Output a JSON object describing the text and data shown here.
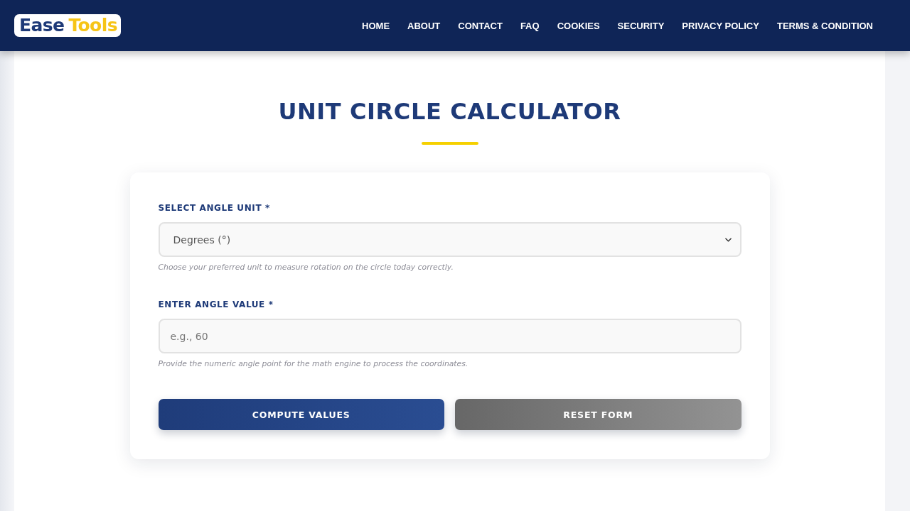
{
  "header": {
    "logo": {
      "word_1": "Ease",
      "word_2": "Tools"
    },
    "nav": [
      "HOME",
      "ABOUT",
      "CONTACT",
      "FAQ",
      "COOKIES",
      "SECURITY",
      "PRIVACY POLICY",
      "TERMS & CONDITION"
    ]
  },
  "page": {
    "title": "UNIT CIRCLE CALCULATOR"
  },
  "form": {
    "fields": [
      {
        "kind": "select",
        "label": "SELECT ANGLE UNIT *",
        "value": "Degrees (°)",
        "hint": "Choose your preferred unit to measure rotation on the circle today correctly."
      },
      {
        "kind": "input",
        "label": "ENTER ANGLE VALUE *",
        "placeholder": "e.g., 60",
        "hint": "Provide the numeric angle point for the math engine to process the coordinates."
      }
    ],
    "buttons": [
      {
        "kind": "primary",
        "label": "COMPUTE VALUES"
      },
      {
        "kind": "secondary",
        "label": "RESET FORM"
      }
    ]
  }
}
